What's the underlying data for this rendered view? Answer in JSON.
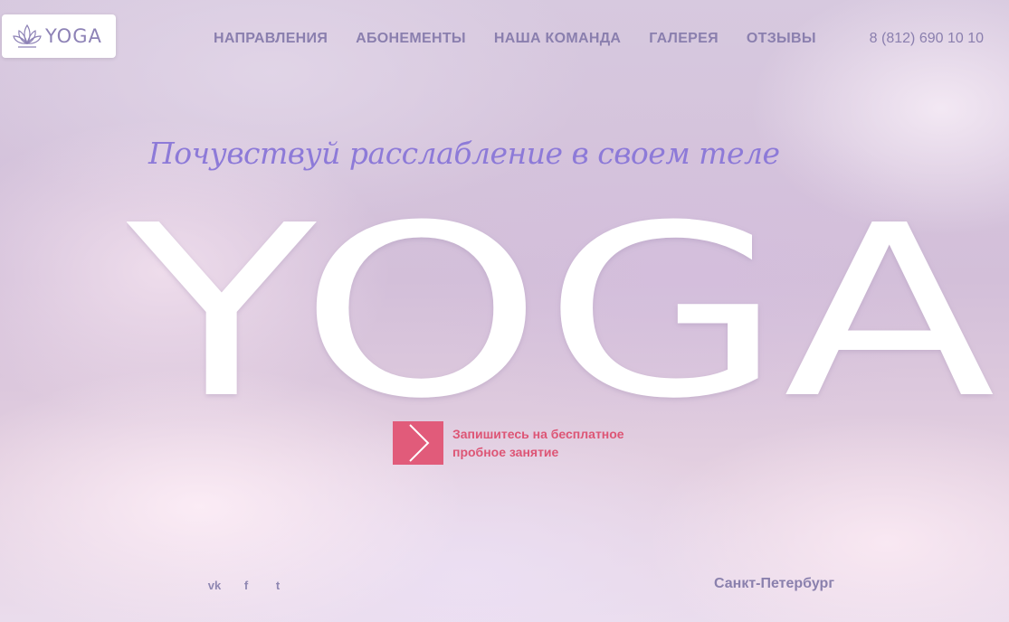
{
  "header": {
    "logo_text": "YOGA",
    "nav": [
      {
        "label": "НАПРАВЛЕНИЯ"
      },
      {
        "label": "АБОНЕМЕНТЫ"
      },
      {
        "label": "НАША КОМАНДА"
      },
      {
        "label": "ГАЛЕРЕЯ"
      },
      {
        "label": "ОТЗЫВЫ"
      }
    ],
    "phone": "8 (812) 690 10 10"
  },
  "hero": {
    "tagline": "Почувствуй расслабление в своем теле",
    "title": "YOGA",
    "cta_text": "Запишитесь на бесплатное пробное занятие"
  },
  "footer": {
    "social": [
      {
        "icon": "vk-icon",
        "glyph": "vk"
      },
      {
        "icon": "facebook-icon",
        "glyph": "f"
      },
      {
        "icon": "twitter-icon",
        "glyph": "t"
      }
    ],
    "city": "Санкт-Петербург"
  },
  "colors": {
    "accent": "#e15b7a",
    "nav": "#8a7fae",
    "tagline": "#8d7ad8"
  }
}
